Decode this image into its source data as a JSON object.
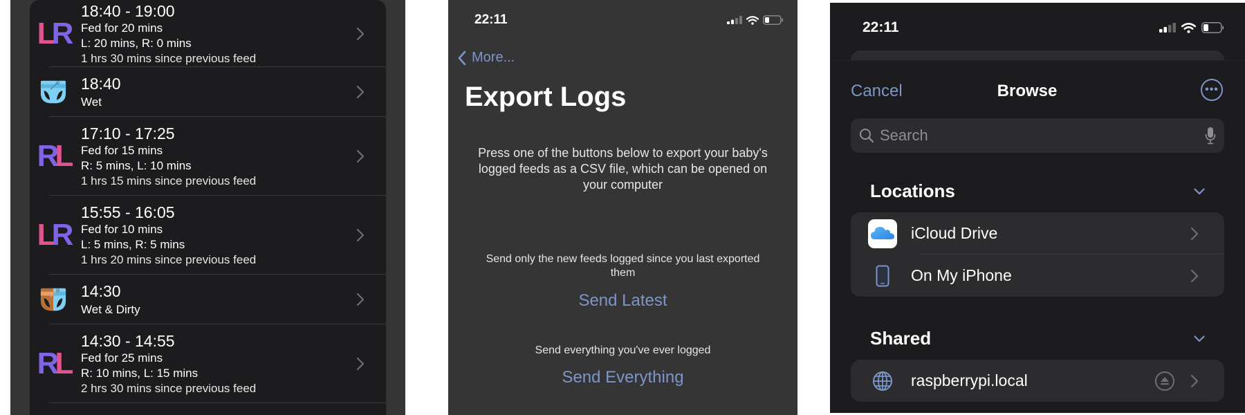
{
  "feed_log": {
    "entries": [
      {
        "type": "feed",
        "time": "18:40 - 19:00",
        "first_side": "L",
        "second_side": "R",
        "summary": "Fed for 20 mins",
        "breakdown": "L: 20 mins, R: 0 mins",
        "since_previous": "1 hrs 30 mins since previous feed"
      },
      {
        "type": "nappy",
        "nappy_kind": "wet",
        "time": "18:40",
        "summary": "Wet"
      },
      {
        "type": "feed",
        "time": "17:10 - 17:25",
        "first_side": "R",
        "second_side": "L",
        "summary": "Fed for 15 mins",
        "breakdown": "R: 5 mins, L: 10 mins",
        "since_previous": "1 hrs 15 mins since previous feed"
      },
      {
        "type": "feed",
        "time": "15:55 - 16:05",
        "first_side": "L",
        "second_side": "R",
        "summary": "Fed for 10 mins",
        "breakdown": "L: 5 mins, R: 5 mins",
        "since_previous": "1 hrs 20 mins since previous feed"
      },
      {
        "type": "nappy",
        "nappy_kind": "wet-dirty",
        "time": "14:30",
        "summary": "Wet & Dirty"
      },
      {
        "type": "feed",
        "time": "14:30 - 14:55",
        "first_side": "R",
        "second_side": "L",
        "summary": "Fed for 25 mins",
        "breakdown": "R: 10 mins, L: 15 mins",
        "since_previous": "2 hrs 30 mins since previous feed"
      }
    ],
    "colors": {
      "left": "#e0538f",
      "right": "#7f64e6",
      "wet": "#7fd0f2",
      "dirty": "#b8703a"
    }
  },
  "export": {
    "status_time": "22:11",
    "back_label": "More...",
    "title": "Export Logs",
    "intro": "Press one of the buttons below to export your baby's logged feeds as a CSV file, which can be opened on your computer",
    "latest_hint": "Send only the new feeds logged since you last exported them",
    "latest_button": "Send Latest",
    "everything_hint": "Send everything you've ever logged",
    "everything_button": "Send Everything",
    "accent": "#7d95c7"
  },
  "browse": {
    "status_time": "22:11",
    "cancel_label": "Cancel",
    "title": "Browse",
    "more_icon": "ellipsis-circle-icon",
    "search_placeholder": "Search",
    "locations": {
      "title": "Locations",
      "items": [
        {
          "label": "iCloud Drive",
          "icon": "icloud-icon"
        },
        {
          "label": "On My iPhone",
          "icon": "iphone-icon"
        }
      ]
    },
    "shared": {
      "title": "Shared",
      "items": [
        {
          "label": "raspberrypi.local",
          "icon": "globe-icon",
          "ejectable": true
        }
      ]
    }
  }
}
